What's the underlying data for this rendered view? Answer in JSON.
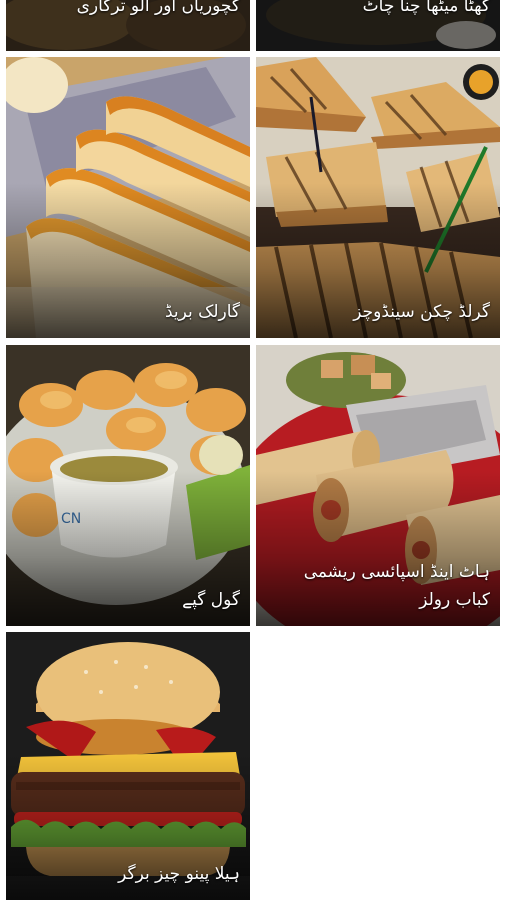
{
  "grid": {
    "items": [
      {
        "name": "کچوریاں اور آلو ترکاری"
      },
      {
        "name": "کھٹا میٹھا چنا چاٹ"
      },
      {
        "name": "گارلک بریڈ"
      },
      {
        "name": "گرلڈ چکن سینڈوچز"
      },
      {
        "name": "گول گپے"
      },
      {
        "name": "ہاٹ اینڈ اسپائسی ریشمی کباب رولز"
      },
      {
        "name": "ہیلا پینو چیز برگر"
      }
    ]
  },
  "colors": {
    "background": "#ffffff",
    "caption_text": "#ffffff"
  },
  "icons": {
    "item_0": "kachori-photo",
    "item_1": "chana-chaat-photo",
    "item_2": "garlic-bread-photo",
    "item_3": "grilled-sandwich-photo",
    "item_4": "gol-gappay-photo",
    "item_5": "kabab-rolls-photo",
    "item_6": "burger-photo"
  }
}
